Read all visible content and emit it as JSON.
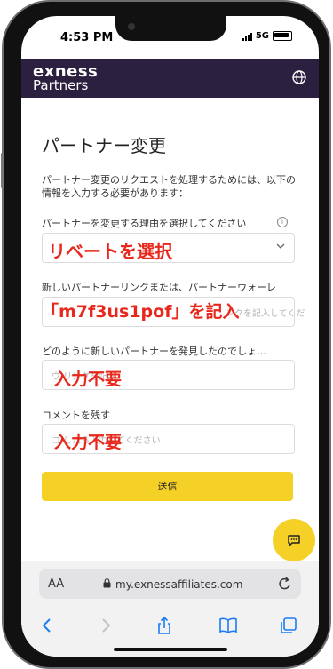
{
  "status": {
    "time": "4:53 PM",
    "network": "5G"
  },
  "header": {
    "logo_top": "exness",
    "logo_bottom": "Partners"
  },
  "page": {
    "title": "パートナー変更",
    "description": "パートナー変更のリクエストを処理するためには、以下の情報を入力する必要があります："
  },
  "fields": {
    "reason": {
      "label": "パートナーを変更する理由を選択してください"
    },
    "link": {
      "label": "新しいパートナーリンクまたは、パートナーウォーレ",
      "placeholder": "ンクを記入してくだ"
    },
    "discover": {
      "label": "どのように新しいパートナーを発見したのでしょ…",
      "placeholder": "ウ    リンクを記入"
    },
    "comment": {
      "label": "コメントを残す",
      "placeholder": "コ         したら入力してください"
    }
  },
  "annotations": {
    "reason": "リベートを選択",
    "link": "「m7f3us1pof」を記入",
    "discover": "入力不要",
    "comment": "入力不要"
  },
  "submit_label": "送信",
  "browser": {
    "aa": "AA",
    "url": "my.exnessaffiliates.com"
  },
  "colors": {
    "header_bg": "#2c2040",
    "accent": "#f5d127",
    "annotation": "#e8281c"
  }
}
